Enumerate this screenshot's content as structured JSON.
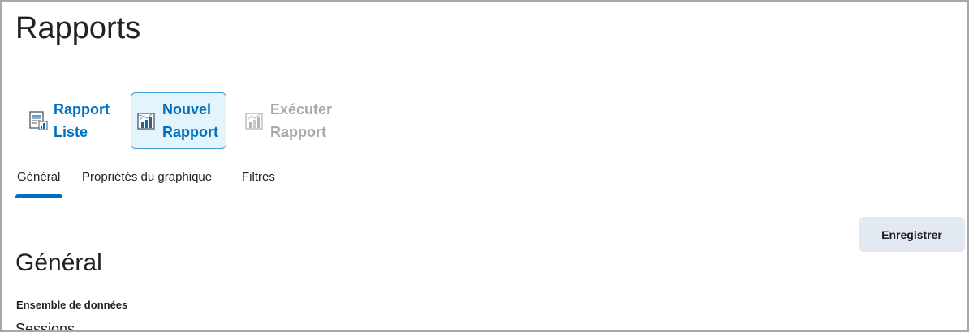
{
  "page": {
    "title": "Rapports"
  },
  "actions": [
    {
      "line1": "Rapport",
      "line2": "Liste",
      "icon": "report-list-icon",
      "state": "enabled"
    },
    {
      "line1": "Nouvel",
      "line2": "Rapport",
      "icon": "new-report-icon",
      "state": "selected"
    },
    {
      "line1": "Exécuter",
      "line2": "Rapport",
      "icon": "run-report-icon",
      "state": "disabled"
    }
  ],
  "tabs": [
    {
      "label": "Général",
      "active": true
    },
    {
      "label": "Propriétés du graphique",
      "active": false
    },
    {
      "label": "Filtres",
      "active": false
    }
  ],
  "toolbar": {
    "save_label": "Enregistrer"
  },
  "section": {
    "heading": "Général",
    "dataset_label": "Ensemble de données",
    "dataset_value": "Sessions"
  },
  "colors": {
    "accent": "#006fbf",
    "selected_bg": "#e3f4fc",
    "disabled_text": "#a8a8a8",
    "button_bg": "#e3e9f1"
  }
}
